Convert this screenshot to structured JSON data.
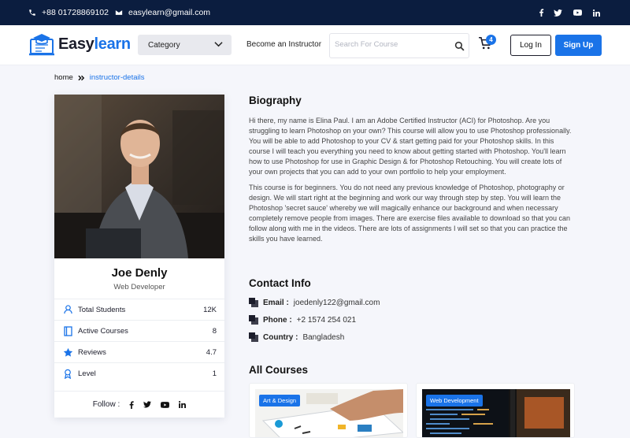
{
  "topbar": {
    "phone": "+88 01728869102",
    "email": "easylearn@gmail.com"
  },
  "brand": {
    "name_part1": "Easy",
    "name_part2": "learn",
    "accent": "#1a73e8",
    "navy": "#0b1d3f"
  },
  "nav": {
    "category_label": "Category",
    "become_instructor": "Become an Instructor",
    "search_placeholder": "Search For Course",
    "cart_count": "4",
    "login": "Log In",
    "signup": "Sign Up"
  },
  "breadcrumb": {
    "home": "home",
    "current": "instructor-details"
  },
  "profile": {
    "name": "Joe Denly",
    "role": "Web Developer",
    "stats": [
      {
        "label": "Total Students",
        "value": "12K",
        "icon": "user-icon"
      },
      {
        "label": "Active Courses",
        "value": "8",
        "icon": "book-icon"
      },
      {
        "label": "Reviews",
        "value": "4.7",
        "icon": "star-icon"
      },
      {
        "label": "Level",
        "value": "1",
        "icon": "medal-icon"
      }
    ],
    "follow_label": "Follow :"
  },
  "biography": {
    "title": "Biography",
    "paragraphs": [
      "Hi there, my name is Elina Paul. I am an Adobe Certified Instructor (ACI) for Photoshop. Are you struggling to learn Photoshop on your own? This course will allow you to use Photoshop professionally. You will be able to add Photoshop to your CV & start getting paid for your Photoshop skills. In this course I will teach you everything you need to know about getting started with Photoshop. You'll learn how to use Photoshop for use in Graphic Design & for Photoshop Retouching. You will create lots of your own projects that you can add to your own portfolio to help your employment.",
      "This course is for beginners. You do not need any previous knowledge of Photoshop, photography or design. We will start right at the beginning and work our way through step by step. You will learn the Photoshop 'secret sauce' whereby we will magically enhance our background and when necessary completely remove people from images. There are exercise files available to download so that you can follow along with me in the videos. There are lots of assignments I will set so that you can practice the skills you have learned."
    ]
  },
  "contact": {
    "title": "Contact Info",
    "email_label": "Email :",
    "email": "joedenly122@gmail.com",
    "phone_label": "Phone :",
    "phone": "+2 1574 254 021",
    "country_label": "Country :",
    "country": "Bangladesh"
  },
  "courses": {
    "title": "All Courses",
    "items": [
      {
        "tag": "Art & Design"
      },
      {
        "tag": "Web Development"
      }
    ]
  }
}
